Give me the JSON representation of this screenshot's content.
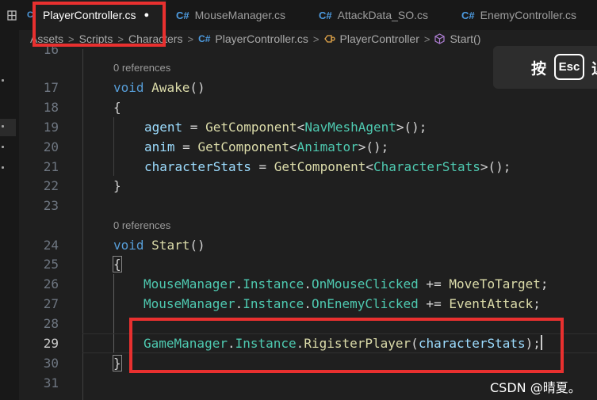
{
  "tabs": [
    {
      "label": "PlayerController.cs",
      "active": true,
      "dirty_marker": "●"
    },
    {
      "label": "MouseManager.cs"
    },
    {
      "label": "AttackData_SO.cs"
    },
    {
      "label": "EnemyController.cs"
    }
  ],
  "tab_icon_glyph": "C#",
  "breadcrumb": {
    "items": [
      "Assets",
      "Scripts",
      "Characters",
      "PlayerController.cs",
      "PlayerController",
      "Start()"
    ],
    "separator": ">"
  },
  "editor": {
    "first_partial_line": "16",
    "codelens_awake": "0 references",
    "codelens_start": "0 references",
    "line_numbers": [
      "17",
      "18",
      "19",
      "20",
      "21",
      "22",
      "23",
      "24",
      "25",
      "26",
      "27",
      "28",
      "29",
      "30",
      "31"
    ],
    "tokens": {
      "void": "void",
      "awake": "Awake",
      "start": "Start",
      "parens": "()",
      "open_brace": "{",
      "close_brace": "}",
      "agent": "agent",
      "anim": "anim",
      "characterStats": "characterStats",
      "eq": " = ",
      "getComponent": "GetComponent",
      "lt": "<",
      "gt_call": ">();",
      "navMeshAgent": "NavMeshAgent",
      "animator": "Animator",
      "characterStatsType": "CharacterStats",
      "mouseManager": "MouseManager",
      "dot": ".",
      "instance": "Instance",
      "onMouseClicked": "OnMouseClicked",
      "onEnemyClicked": "OnEnemyClicked",
      "plusEq": " += ",
      "moveToTarget": "MoveToTarget",
      "eventAttack": "EventAttack",
      "semicolon": ";",
      "gameManager": "GameManager",
      "rigisterPlayer": "RigisterPlayer",
      "open_paren": "(",
      "close_call": ");"
    }
  },
  "toast": {
    "before": "按",
    "key": "Esc",
    "after": "退"
  },
  "watermark": "CSDN @晴夏。",
  "colors": {
    "keyword": "#569cd6",
    "function": "#dcdcaa",
    "variable": "#9cdcfe",
    "type": "#4ec9b0",
    "annotation_red": "#e8302f"
  }
}
